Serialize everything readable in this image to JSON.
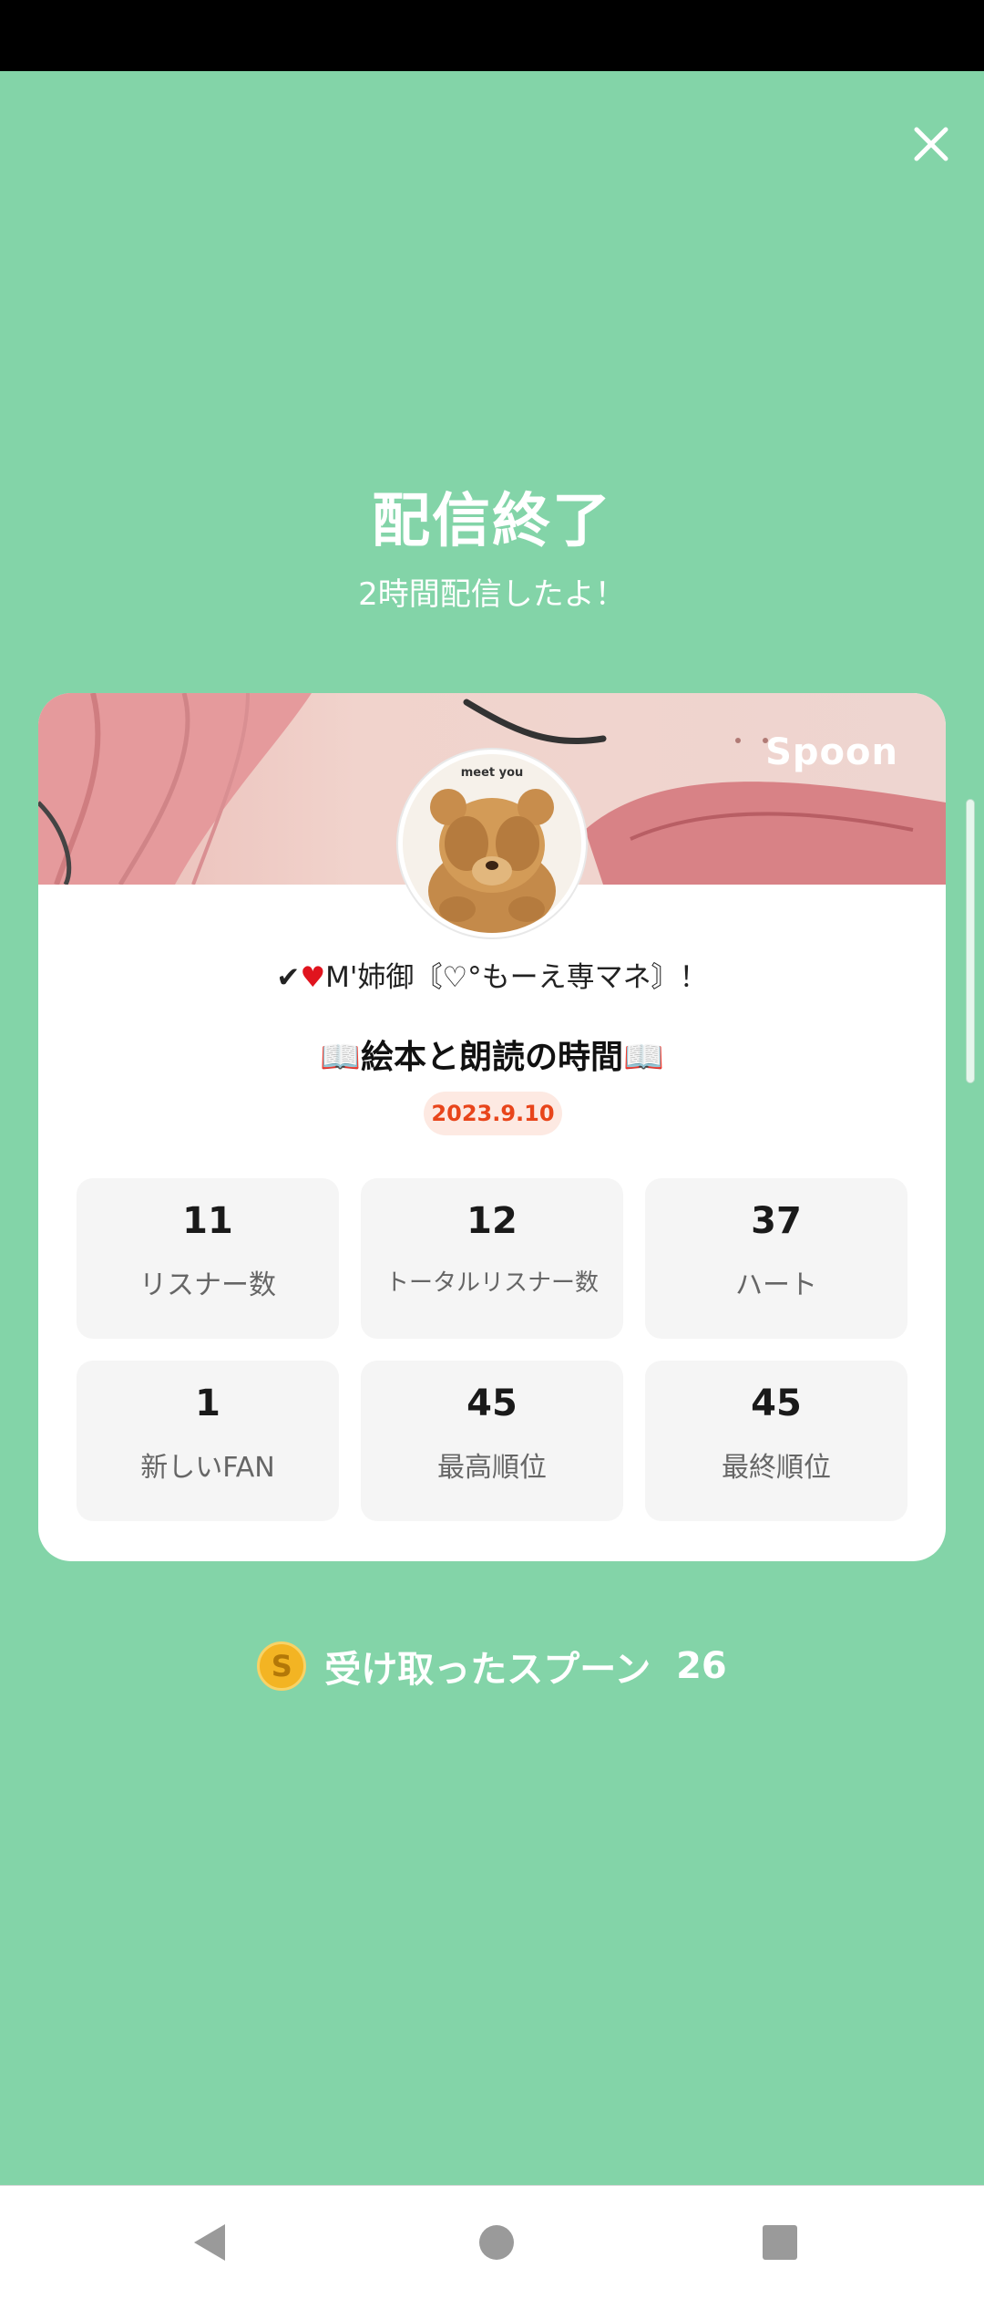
{
  "header": {
    "title": "配信終了",
    "subtitle": "2時間配信したよ！"
  },
  "card": {
    "brand": "Spoon",
    "username": "M'姉御〘♡°もーえ専マネ〙！",
    "show_title": "絵本と朗読の時間",
    "date": "2023.9.10",
    "stats": [
      {
        "value": "11",
        "label": "リスナー数"
      },
      {
        "value": "12",
        "label": "トータルリスナー数"
      },
      {
        "value": "37",
        "label": "ハート"
      },
      {
        "value": "1",
        "label": "新しいFAN"
      },
      {
        "value": "45",
        "label": "最高順位"
      },
      {
        "value": "45",
        "label": "最終順位"
      }
    ]
  },
  "footer": {
    "coin_symbol": "S",
    "spoons_label": "受け取ったスプーン",
    "spoons_count": "26"
  },
  "colors": {
    "background": "#83d4a8",
    "date_text": "#e8451b",
    "date_bg": "#fde9e2",
    "coin": "#f3b423"
  },
  "icons": {
    "close": "close-icon",
    "check": "check-icon",
    "heart": "heart-icon",
    "book": "open-book-icon",
    "coin": "spoon-coin-icon",
    "nav_back": "back-triangle-icon",
    "nav_home": "home-circle-icon",
    "nav_recents": "recents-square-icon"
  }
}
